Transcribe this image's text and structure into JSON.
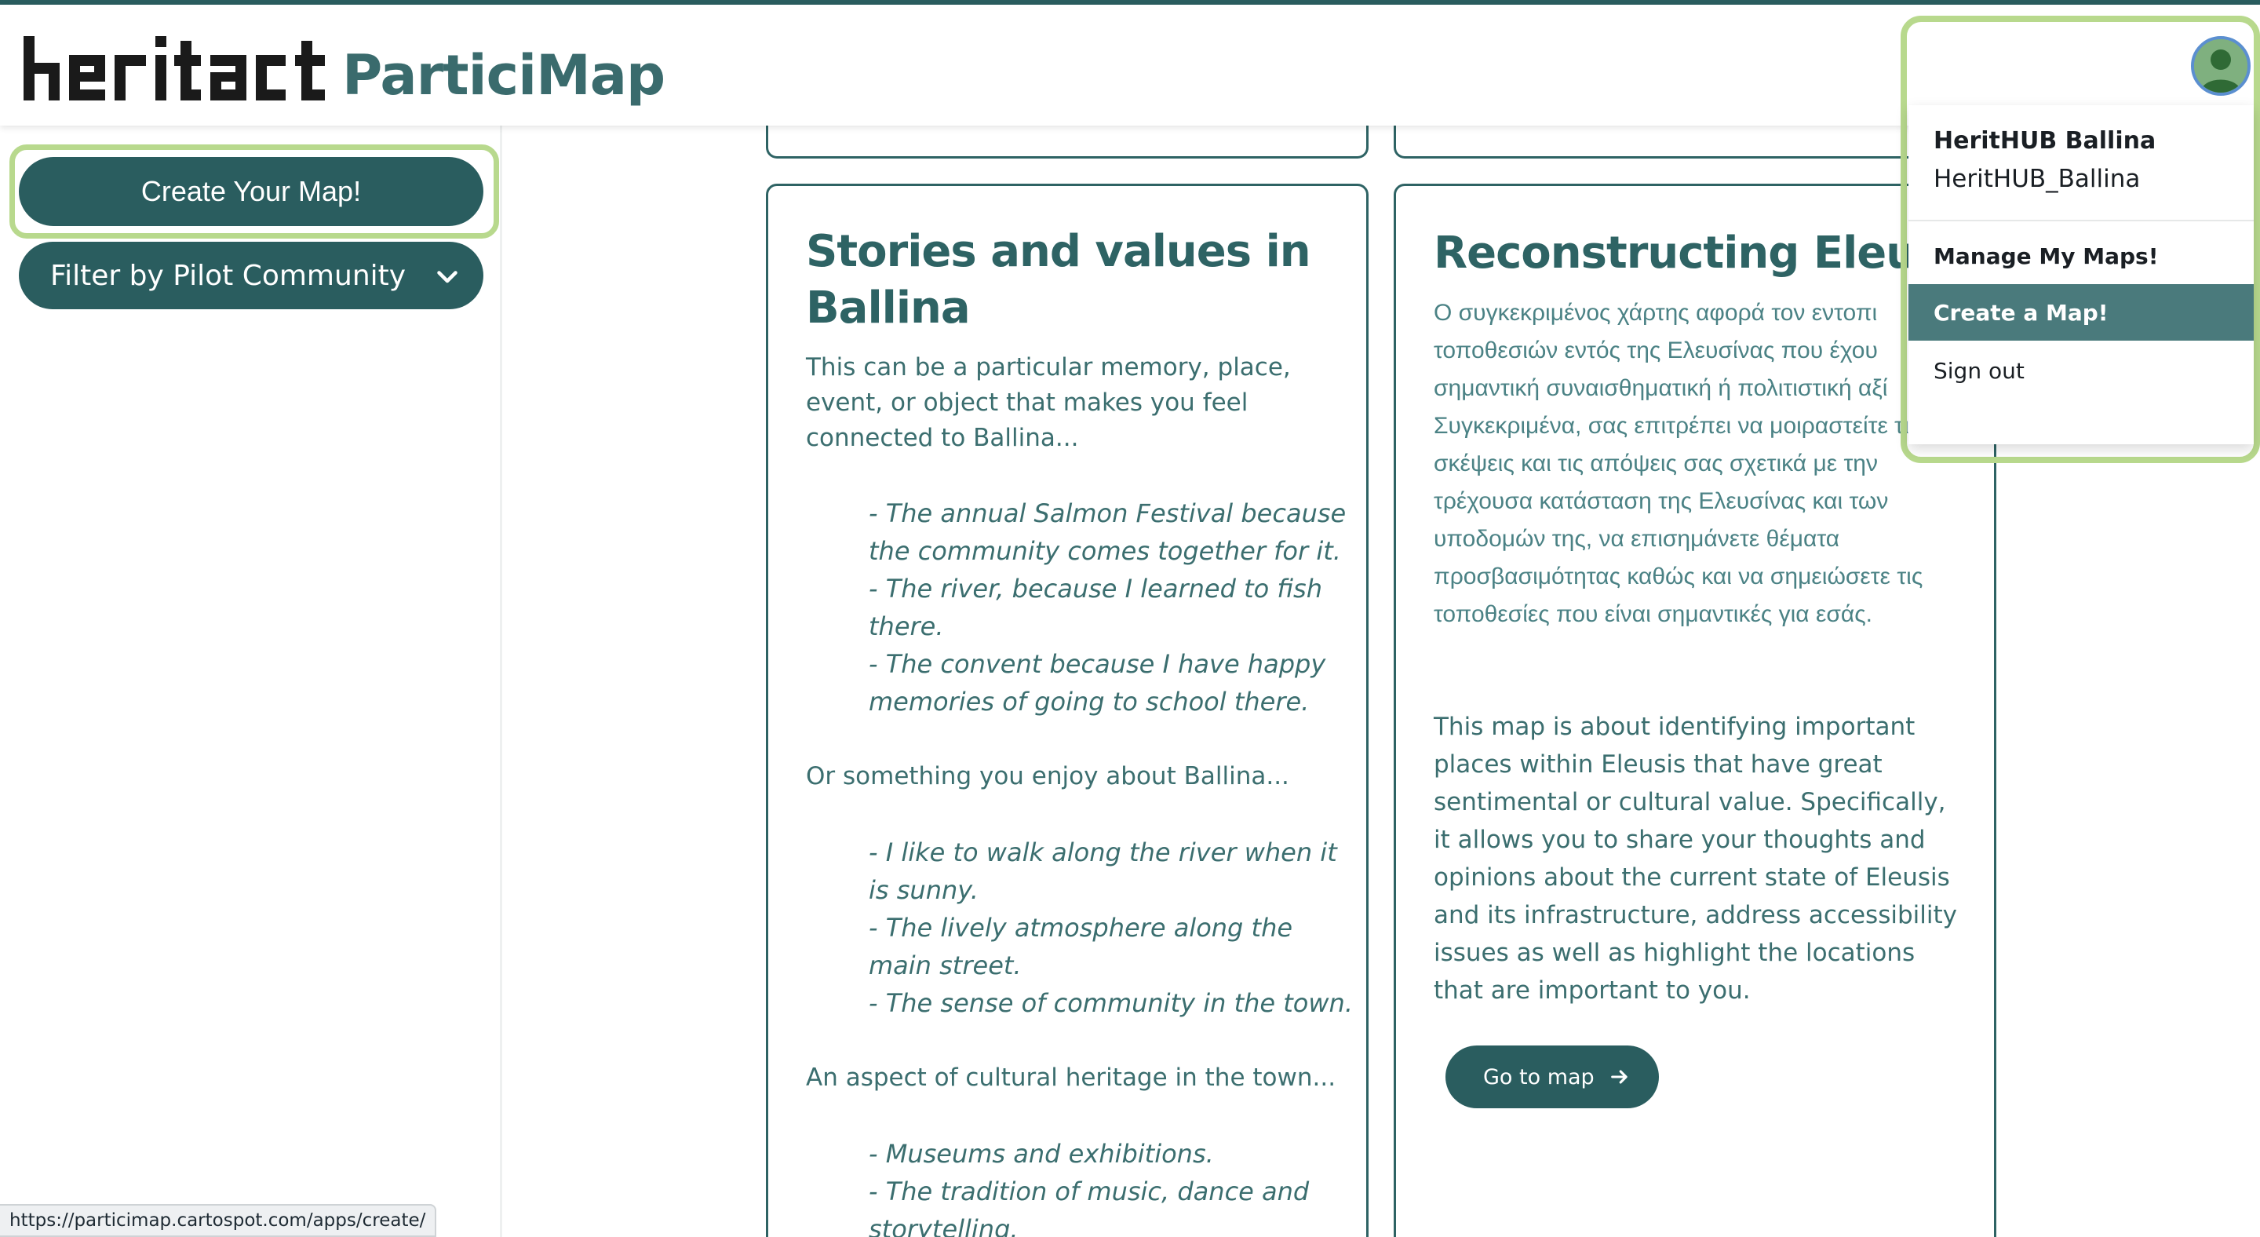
{
  "header": {
    "logo_text": "heritact",
    "app_title": "ParticiMap"
  },
  "sidebar": {
    "create_button": "Create Your Map!",
    "filter_button": "Filter by Pilot Community"
  },
  "cards": [
    {
      "title_line1": "Stories and values in",
      "title_line2": "Ballina",
      "intro": [
        "This can be a particular memory, place,",
        "event, or object that makes you feel",
        "connected to Ballina..."
      ],
      "examples1": [
        "- The annual Salmon Festival because",
        "the community comes together for it.",
        "- The river, because I learned to fish",
        "there.",
        "- The convent because I have happy",
        "memories of going to school there."
      ],
      "section2": "Or something you enjoy about Ballina...",
      "examples2": [
        "- I like to walk along the river when it",
        "is sunny.",
        "- The lively atmosphere along the",
        "main street.",
        "- The sense of community in the town."
      ],
      "section3": "An aspect of cultural heritage in the town...",
      "examples3": [
        "- Museums and exhibitions.",
        "- The tradition of music, dance and",
        "storytelling."
      ]
    },
    {
      "title": "Reconstructing Eleusis",
      "greek": [
        "Ο συγκεκριμένος χάρτης αφορά τον εντοπι",
        "τοποθεσιών εντός της Ελευσίνας που έχου",
        "σημαντική συναισθηματική ή πολιτιστική αξί",
        "Συγκεκριμένα, σας επιτρέπει να μοιραστείτε τις",
        "σκέψεις και τις απόψεις σας σχετικά με την",
        "τρέχουσα κατάσταση της Ελευσίνας και των",
        "υποδομών της, να επισημάνετε θέματα",
        "προσβασιμότητας καθώς και να σημειώσετε τις",
        "τοποθεσίες που είναι σημαντικές για εσάς."
      ],
      "english": [
        "This map is about identifying important",
        "places within Eleusis that have great",
        "sentimental or cultural value. Specifically,",
        "it allows you to share your thoughts and",
        "opinions about the current state of Eleusis",
        "and its infrastructure, address accessibility",
        "issues as well as highlight the locations",
        "that are important to you."
      ],
      "button": "Go to map"
    }
  ],
  "user_menu": {
    "display_name": "HeritHUB Ballina",
    "username": "HeritHUB_Ballina",
    "items": [
      "Manage My Maps!",
      "Create a Map!",
      "Sign out"
    ],
    "active_item": "Create a Map!"
  },
  "status_bar": {
    "url": "https://particimap.cartospot.com/apps/create/"
  },
  "colors": {
    "brand": "#2a5d5f",
    "highlight": "#b8d98d",
    "menu_active": "#4a7a7c"
  },
  "icons": [
    "chevron-down-icon",
    "arrow-right-icon",
    "user-avatar-icon"
  ]
}
